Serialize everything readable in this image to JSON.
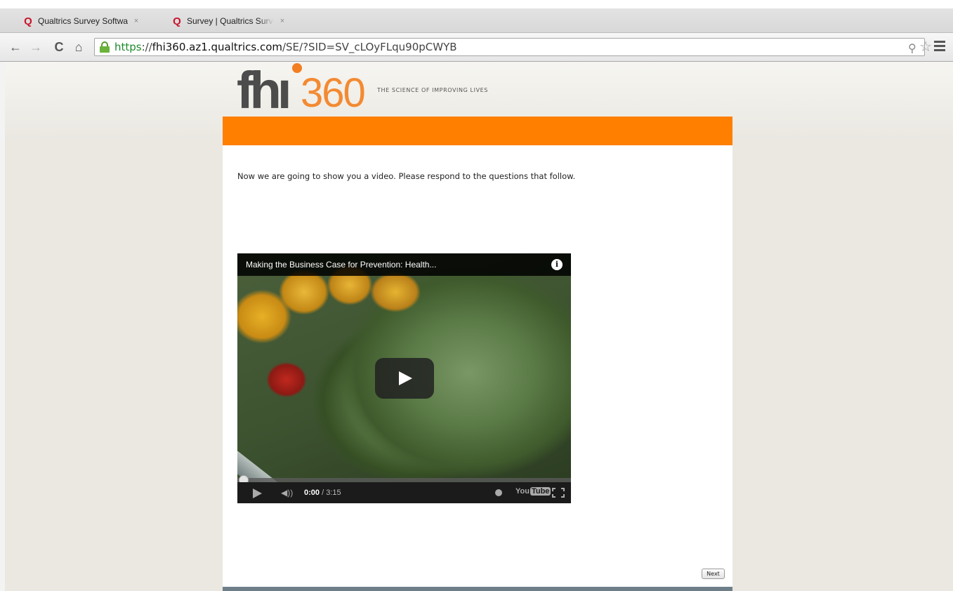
{
  "browser": {
    "tabs": [
      {
        "title": "Qualtrics Survey Software",
        "active": false
      },
      {
        "title": "Survey | Qualtrics Survey Software",
        "active": true
      }
    ],
    "close_glyph": "×",
    "url": {
      "scheme": "https",
      "separator": "://",
      "host": "fhi360.az1.qualtrics.com",
      "path": "/SE/?SID=SV_cLOyFLqu90pCWYB"
    },
    "icons": {
      "back": "←",
      "forward": "→",
      "reload": "C",
      "home": "⌂",
      "zoom": "⚲",
      "star": "☆"
    },
    "favicon_glyph": "Q"
  },
  "header": {
    "logo_fhi": "fh",
    "logo_i": "ı",
    "logo_360": "360",
    "tagline": "THE SCIENCE OF IMPROVING LIVES",
    "brand_color": "#ff7f00"
  },
  "question": {
    "text": "Now we are going to show you a video. Please respond to the questions that follow."
  },
  "video": {
    "title": "Making the Business Case for Prevention: Health...",
    "info_glyph": "i",
    "current_time": "0:00",
    "duration": " / 3:15",
    "volume_glyph": "◀))",
    "youtube_you": "You",
    "youtube_tube": "Tube",
    "progress": 0
  },
  "navigation": {
    "next_label": "Next"
  }
}
